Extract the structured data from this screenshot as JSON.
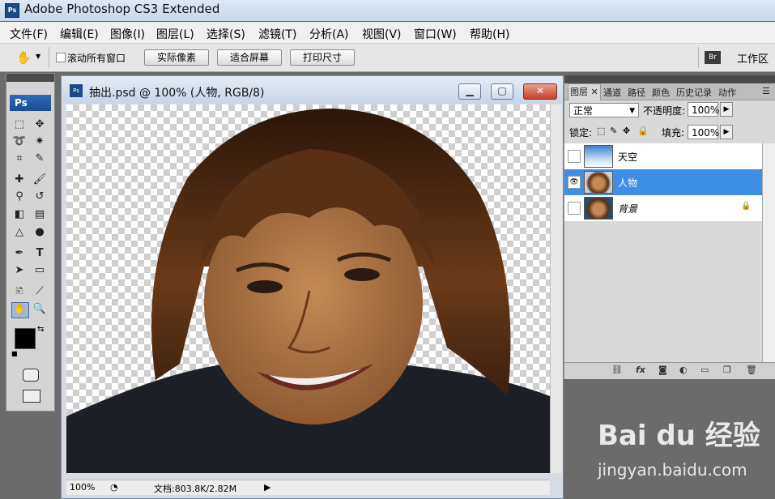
{
  "app": {
    "title": "Adobe Photoshop CS3 Extended",
    "logo": "Ps"
  },
  "menu": [
    "文件(F)",
    "编辑(E)",
    "图像(I)",
    "图层(L)",
    "选择(S)",
    "滤镜(T)",
    "分析(A)",
    "视图(V)",
    "窗口(W)",
    "帮助(H)"
  ],
  "options": {
    "scroll_all": "滚动所有窗口",
    "actual_pixels": "实际像素",
    "fit_screen": "适合屏幕",
    "print_size": "打印尺寸",
    "bridge": "Br",
    "workspace": "工作区"
  },
  "toolbox": {
    "logo": "Ps"
  },
  "document": {
    "title": "抽出.psd @ 100% (人物, RGB/8)",
    "zoom": "100%",
    "doc_info": "文档:803.8K/2.82M",
    "icon": "Ps"
  },
  "layers_panel": {
    "tabs": [
      "图层",
      "通道",
      "路径",
      "颜色",
      "历史记录",
      "动作"
    ],
    "blend_mode": "正常",
    "opacity_label": "不透明度:",
    "opacity_value": "100%",
    "lock_label": "锁定:",
    "fill_label": "填充:",
    "fill_value": "100%",
    "layers": [
      {
        "name": "天空",
        "visible": false,
        "selected": false
      },
      {
        "name": "人物",
        "visible": true,
        "selected": true
      },
      {
        "name": "背景",
        "visible": false,
        "selected": false,
        "locked": true
      }
    ],
    "bottom_fx": "fx"
  },
  "watermark": {
    "logo": "Bai du 经验",
    "site": "jingyan.baidu.com"
  },
  "colors": {
    "selection": "#3e8ee6",
    "canvas_check": "#cfcfcf",
    "workspace": "#6b6b6b"
  }
}
